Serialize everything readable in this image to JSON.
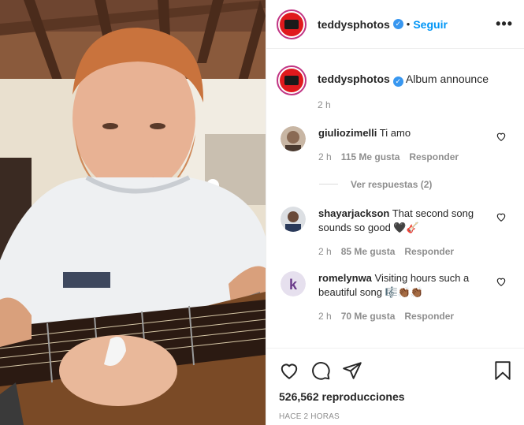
{
  "post": {
    "username": "teddysphotos",
    "separator": "•",
    "follow_label": "Seguir",
    "more_label": "•••"
  },
  "caption": {
    "username": "teddysphotos",
    "text": "Album announce",
    "time": "2 h"
  },
  "comments": [
    {
      "username": "giuliozimelli",
      "text": "Ti amo",
      "time": "2 h",
      "likes": "115 Me gusta",
      "reply": "Responder",
      "view_replies": "Ver respuestas (2)"
    },
    {
      "username": "shayarjackson",
      "text": "That second song sounds so good 🖤🎸",
      "time": "2 h",
      "likes": "85 Me gusta",
      "reply": "Responder"
    },
    {
      "username": "romelynwa",
      "text": "Visiting hours such a beautiful song 🎼👏🏾👏🏾",
      "time": "2 h",
      "likes": "70 Me gusta",
      "reply": "Responder"
    }
  ],
  "footer": {
    "views": "526,562 reproducciones",
    "posted_ago": "HACE 2 HORAS"
  },
  "colors": {
    "accent": "#0095f6",
    "verified": "#3897f0",
    "avatar_ring": "#c13584",
    "avatar_bg": "#e0191d"
  },
  "icons": [
    "heart-icon",
    "comment-icon",
    "share-icon",
    "bookmark-icon",
    "verified-icon",
    "more-options-icon"
  ]
}
